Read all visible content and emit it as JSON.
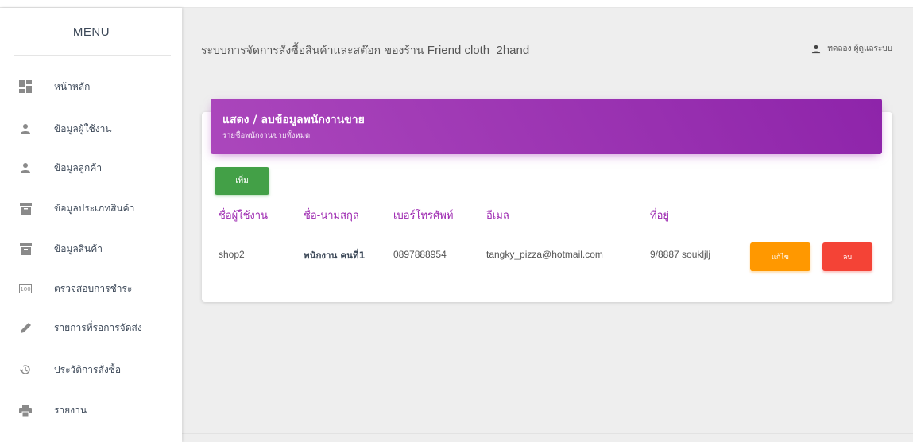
{
  "sidebar": {
    "title": "MENU",
    "items": [
      {
        "label": "หน้าหลัก",
        "icon": "dashboard-icon"
      },
      {
        "label": "ข้อมูลผู้ใช้งาน",
        "icon": "person-icon"
      },
      {
        "label": "ข้อมูลลูกค้า",
        "icon": "person-icon"
      },
      {
        "label": "ข้อมูลประเภทสินค้า",
        "icon": "archive-icon"
      },
      {
        "label": "ข้อมูลสินค้า",
        "icon": "archive-icon"
      },
      {
        "label": "ตรวจสอบการชำระ",
        "icon": "money-icon"
      },
      {
        "label": "รายการที่รอการจัดส่ง",
        "icon": "pencil-icon"
      },
      {
        "label": "ประวัติการสั่งซื้อ",
        "icon": "history-icon"
      },
      {
        "label": "รายงาน",
        "icon": "print-icon"
      }
    ]
  },
  "header": {
    "title_th": "ระบบการจัดการสั่งซื้อสินค้าและสต๊อก ของร้าน",
    "title_en": "Friend cloth_2hand",
    "user": "ทดลอง ผู้ดูแลระบบ"
  },
  "card": {
    "title": "แสดง / ลบข้อมูลพนักงานขาย",
    "subtitle": "รายชื่อพนักงานขายทั้งหมด",
    "add_label": "เพิ่ม",
    "columns": [
      "ชื่อผู้ใช้งาน",
      "ชื่อ-นามสกุล",
      "เบอร์โทรศัพท์",
      "อีเมล",
      "ที่อยู่"
    ],
    "rows": [
      {
        "username": "shop2",
        "fullname": "พนักงาน คนที่1",
        "phone": "0897888954",
        "email": "tangky_pizza@hotmail.com",
        "address": "9/8887 soukljlj",
        "edit_label": "แก้ไข",
        "delete_label": "ลบ"
      }
    ]
  },
  "colors": {
    "header_gradient_start": "#ab47bc",
    "header_gradient_end": "#8e24aa",
    "column_header": "#9c27b0",
    "add_button": "#43a047",
    "edit_button": "#ff9800",
    "delete_button": "#f44336"
  }
}
